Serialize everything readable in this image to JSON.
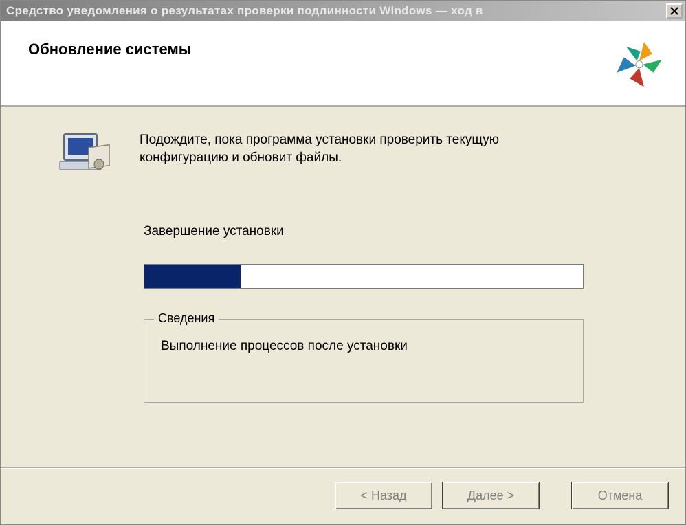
{
  "titlebar": {
    "title": "Средство уведомления о результатах проверки подлинности Windows — ход в"
  },
  "header": {
    "title": "Обновление системы"
  },
  "content": {
    "instruction": "Подождите, пока программа установки проверить текущую конфигурацию и обновит файлы.",
    "status_label": "Завершение установки",
    "progress_percent": 22,
    "groupbox_title": "Сведения",
    "groupbox_body": "Выполнение процессов после установки"
  },
  "buttons": {
    "back": "< Назад",
    "next_prefix": "Д",
    "next_rest": "алее >",
    "cancel": "Отмена"
  }
}
